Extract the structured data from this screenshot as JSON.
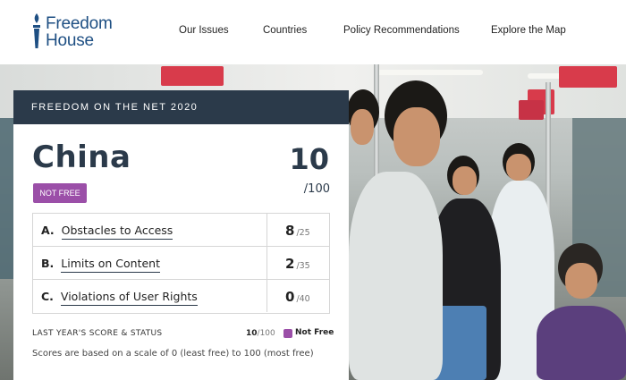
{
  "header": {
    "logo_line1": "Freedom",
    "logo_line2": "House",
    "nav": [
      "Our Issues",
      "Countries",
      "Policy Recommendations",
      "Explore the Map"
    ]
  },
  "card": {
    "eyebrow": "FREEDOM ON THE NET 2020",
    "country": "China",
    "score": "10",
    "score_max": "/100",
    "status": "NOT FREE",
    "rows": [
      {
        "letter": "A.",
        "label": "Obstacles to Access",
        "score": "8",
        "max": "/25"
      },
      {
        "letter": "B.",
        "label": "Limits on Content",
        "score": "2",
        "max": "/35"
      },
      {
        "letter": "C.",
        "label": "Violations of User Rights",
        "score": "0",
        "max": "/40"
      }
    ],
    "last_year_label": "LAST YEAR'S SCORE & STATUS",
    "last_year_score": "10",
    "last_year_max": "/100",
    "last_year_status": "Not Free",
    "note": "Scores are based on a scale of 0 (least free) to 100 (most free)"
  },
  "colors": {
    "navy": "#2b3a4a",
    "not_free": "#9b4fa8",
    "brand": "#1e4f83"
  }
}
